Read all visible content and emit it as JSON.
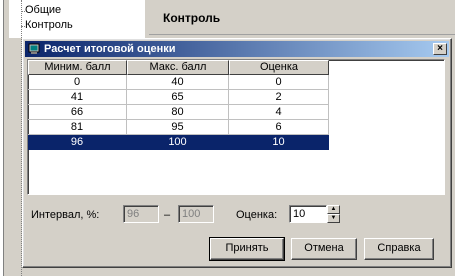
{
  "tree": {
    "items": [
      "Общие",
      "Контроль"
    ]
  },
  "header": {
    "title": "Контроль"
  },
  "dialog": {
    "title": "Расчет итоговой оценки",
    "close_glyph": "×",
    "columns": [
      "Миним. балл",
      "Макс. балл",
      "Оценка"
    ],
    "rows": [
      [
        "0",
        "40",
        "0"
      ],
      [
        "41",
        "65",
        "2"
      ],
      [
        "66",
        "80",
        "4"
      ],
      [
        "81",
        "95",
        "6"
      ],
      [
        "96",
        "100",
        "10"
      ]
    ],
    "selected_row_index": 4,
    "interval_label": "Интервал, %:",
    "interval_from": "96",
    "interval_dash": "–",
    "interval_to": "100",
    "grade_label": "Оценка:",
    "grade_value": "10",
    "buttons": {
      "accept": "Принять",
      "cancel": "Отмена",
      "help": "Справка"
    }
  },
  "colors": {
    "selection": "#0a246a",
    "face": "#d4d0c8"
  }
}
